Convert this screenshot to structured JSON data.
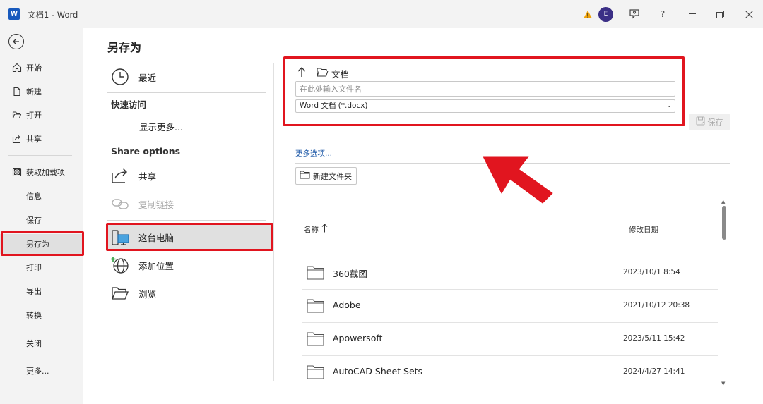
{
  "window": {
    "title": "文档1  -  Word",
    "logo_letter": "W",
    "avatar_initial": "E",
    "help_label": "?"
  },
  "leftnav": {
    "items": [
      {
        "label": "开始",
        "icon": "home-icon"
      },
      {
        "label": "新建",
        "icon": "new-file-icon"
      },
      {
        "label": "打开",
        "icon": "open-folder-icon"
      },
      {
        "label": "共享",
        "icon": "share-icon"
      },
      {
        "label": "获取加载项",
        "icon": "addins-grid-icon"
      },
      {
        "label": "信息"
      },
      {
        "label": "保存"
      },
      {
        "label": "另存为",
        "selected": true
      },
      {
        "label": "打印"
      },
      {
        "label": "导出"
      },
      {
        "label": "转换"
      },
      {
        "label": "关闭"
      },
      {
        "label": "更多..."
      }
    ]
  },
  "saveas": {
    "title": "另存为",
    "recent_label": "最近",
    "quick_access_heading": "快速访问",
    "show_more_label": "显示更多...",
    "share_options_heading": "Share options",
    "share_label": "共享",
    "copy_link_label": "复制链接",
    "this_pc_label": "这台电脑",
    "add_place_label": "添加位置",
    "browse_label": "浏览"
  },
  "right": {
    "path_label": "文档",
    "filename_placeholder": "在此处输入文件名",
    "filetype_value": "Word 文档 (*.docx)",
    "save_label": "保存",
    "more_options_label": "更多选项...",
    "new_folder_label": "新建文件夹",
    "col_name": "名称",
    "col_date": "修改日期",
    "files": [
      {
        "name": "360截图",
        "date": "2023/10/1 8:54"
      },
      {
        "name": "Adobe",
        "date": "2021/10/12 20:38"
      },
      {
        "name": "Apowersoft",
        "date": "2023/5/11 15:42"
      },
      {
        "name": "AutoCAD Sheet Sets",
        "date": "2024/4/27 14:41"
      }
    ]
  },
  "colors": {
    "highlight_box": "#e1151f",
    "word_blue": "#185abd",
    "warning": "#f0a30a",
    "avatar": "#3b2f86"
  }
}
